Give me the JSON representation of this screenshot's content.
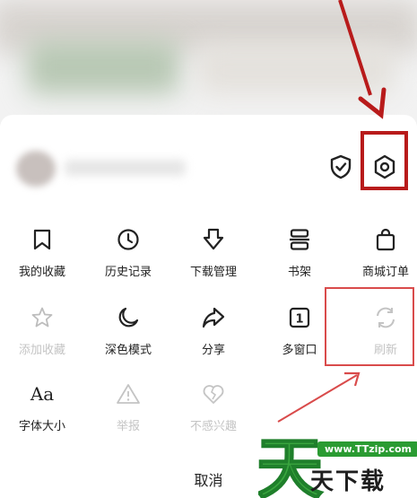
{
  "header": {
    "shield_icon": "shield-check-icon",
    "settings_icon": "hexagon-settings-icon"
  },
  "menu": {
    "row1": [
      {
        "label": "我的收藏",
        "icon": "bookmark-icon"
      },
      {
        "label": "历史记录",
        "icon": "clock-icon"
      },
      {
        "label": "下载管理",
        "icon": "download-arrow-icon"
      },
      {
        "label": "书架",
        "icon": "bookshelf-icon"
      },
      {
        "label": "商城订单",
        "icon": "shopping-bag-icon"
      }
    ],
    "row2": [
      {
        "label": "添加收藏",
        "icon": "star-icon",
        "disabled": true
      },
      {
        "label": "深色模式",
        "icon": "moon-icon"
      },
      {
        "label": "分享",
        "icon": "share-arrow-icon"
      },
      {
        "label": "多窗口",
        "icon": "window-count-icon",
        "badge": "1"
      },
      {
        "label": "刷新",
        "icon": "refresh-icon",
        "disabled": true
      }
    ],
    "row3": [
      {
        "label": "字体大小",
        "icon": "font-size-icon",
        "glyph": "Aa"
      },
      {
        "label": "举报",
        "icon": "warning-icon",
        "disabled": true
      },
      {
        "label": "不感兴趣",
        "icon": "broken-heart-icon",
        "disabled": true
      }
    ]
  },
  "footer": {
    "cancel_label": "取消"
  },
  "watermark": {
    "url": "www.TTzip.com",
    "text": "天下载",
    "big_char": "天"
  },
  "colors": {
    "highlight": "#b81b1b",
    "watermark_green": "#2a9b32"
  }
}
